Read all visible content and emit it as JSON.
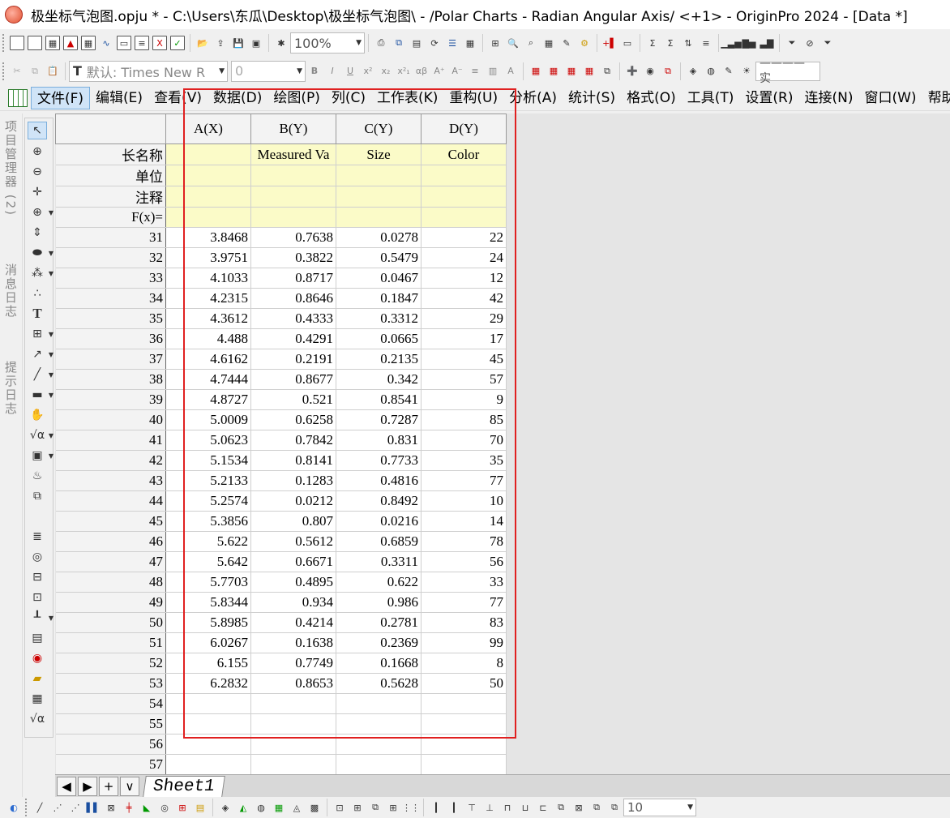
{
  "window": {
    "title": "极坐标气泡图.opju * - C:\\Users\\东瓜\\Desktop\\极坐标气泡图\\ - /Polar Charts - Radian Angular Axis/ <+1> - OriginPro 2024 - [Data *]"
  },
  "toolbar": {
    "zoom": "100%",
    "font_name": "默认: Times New R",
    "font_size": "0",
    "line_style": "———— 实"
  },
  "menu": {
    "items": [
      "文件(F)",
      "编辑(E)",
      "查看(V)",
      "数据(D)",
      "绘图(P)",
      "列(C)",
      "工作表(K)",
      "重构(U)",
      "分析(A)",
      "统计(S)",
      "格式(O)",
      "工具(T)",
      "设置(R)",
      "连接(N)",
      "窗口(W)",
      "帮助"
    ]
  },
  "side_tabs": {
    "project_manager": "项目管理器 (2)",
    "message_log": "消息日志",
    "hint_log": "提示日志"
  },
  "worksheet": {
    "columns": [
      "A(X)",
      "B(Y)",
      "C(Y)",
      "D(Y)"
    ],
    "label_rows": {
      "long_name": {
        "header": "长名称",
        "values": [
          "",
          "Measured Va",
          "Size",
          "Color"
        ]
      },
      "units": {
        "header": "单位",
        "values": [
          "",
          "",
          "",
          ""
        ]
      },
      "comments": {
        "header": "注释",
        "values": [
          "",
          "",
          "",
          ""
        ]
      },
      "fx": {
        "header": "F(x)=",
        "values": [
          "",
          "",
          "",
          ""
        ]
      }
    },
    "rows": [
      {
        "n": "31",
        "a": "3.8468",
        "b": "0.7638",
        "c": "0.0278",
        "d": "22"
      },
      {
        "n": "32",
        "a": "3.9751",
        "b": "0.3822",
        "c": "0.5479",
        "d": "24"
      },
      {
        "n": "33",
        "a": "4.1033",
        "b": "0.8717",
        "c": "0.0467",
        "d": "12"
      },
      {
        "n": "34",
        "a": "4.2315",
        "b": "0.8646",
        "c": "0.1847",
        "d": "42"
      },
      {
        "n": "35",
        "a": "4.3612",
        "b": "0.4333",
        "c": "0.3312",
        "d": "29"
      },
      {
        "n": "36",
        "a": "4.488",
        "b": "0.4291",
        "c": "0.0665",
        "d": "17"
      },
      {
        "n": "37",
        "a": "4.6162",
        "b": "0.2191",
        "c": "0.2135",
        "d": "45"
      },
      {
        "n": "38",
        "a": "4.7444",
        "b": "0.8677",
        "c": "0.342",
        "d": "57"
      },
      {
        "n": "39",
        "a": "4.8727",
        "b": "0.521",
        "c": "0.8541",
        "d": "9"
      },
      {
        "n": "40",
        "a": "5.0009",
        "b": "0.6258",
        "c": "0.7287",
        "d": "85"
      },
      {
        "n": "41",
        "a": "5.0623",
        "b": "0.7842",
        "c": "0.831",
        "d": "70"
      },
      {
        "n": "42",
        "a": "5.1534",
        "b": "0.8141",
        "c": "0.7733",
        "d": "35"
      },
      {
        "n": "43",
        "a": "5.2133",
        "b": "0.1283",
        "c": "0.4816",
        "d": "77"
      },
      {
        "n": "44",
        "a": "5.2574",
        "b": "0.0212",
        "c": "0.8492",
        "d": "10"
      },
      {
        "n": "45",
        "a": "5.3856",
        "b": "0.807",
        "c": "0.0216",
        "d": "14"
      },
      {
        "n": "46",
        "a": "5.622",
        "b": "0.5612",
        "c": "0.6859",
        "d": "78"
      },
      {
        "n": "47",
        "a": "5.642",
        "b": "0.6671",
        "c": "0.3311",
        "d": "56"
      },
      {
        "n": "48",
        "a": "5.7703",
        "b": "0.4895",
        "c": "0.622",
        "d": "33"
      },
      {
        "n": "49",
        "a": "5.8344",
        "b": "0.934",
        "c": "0.986",
        "d": "77"
      },
      {
        "n": "50",
        "a": "5.8985",
        "b": "0.4214",
        "c": "0.2781",
        "d": "83"
      },
      {
        "n": "51",
        "a": "6.0267",
        "b": "0.1638",
        "c": "0.2369",
        "d": "99"
      },
      {
        "n": "52",
        "a": "6.155",
        "b": "0.7749",
        "c": "0.1668",
        "d": "8"
      },
      {
        "n": "53",
        "a": "6.2832",
        "b": "0.8653",
        "c": "0.5628",
        "d": "50"
      },
      {
        "n": "54",
        "a": "",
        "b": "",
        "c": "",
        "d": ""
      },
      {
        "n": "55",
        "a": "",
        "b": "",
        "c": "",
        "d": ""
      },
      {
        "n": "56",
        "a": "",
        "b": "",
        "c": "",
        "d": ""
      },
      {
        "n": "57",
        "a": "",
        "b": "",
        "c": "",
        "d": ""
      }
    ]
  },
  "sheet_tabs": {
    "nav": [
      "◀",
      "▶",
      "+",
      "∨"
    ],
    "active": "Sheet1"
  },
  "bottom_toolbar": {
    "size_value": "10"
  },
  "colors": {
    "label_row_bg": "#fbfbc8",
    "highlight_border": "#e02020",
    "menu_active_bg": "#d0e4f7"
  }
}
